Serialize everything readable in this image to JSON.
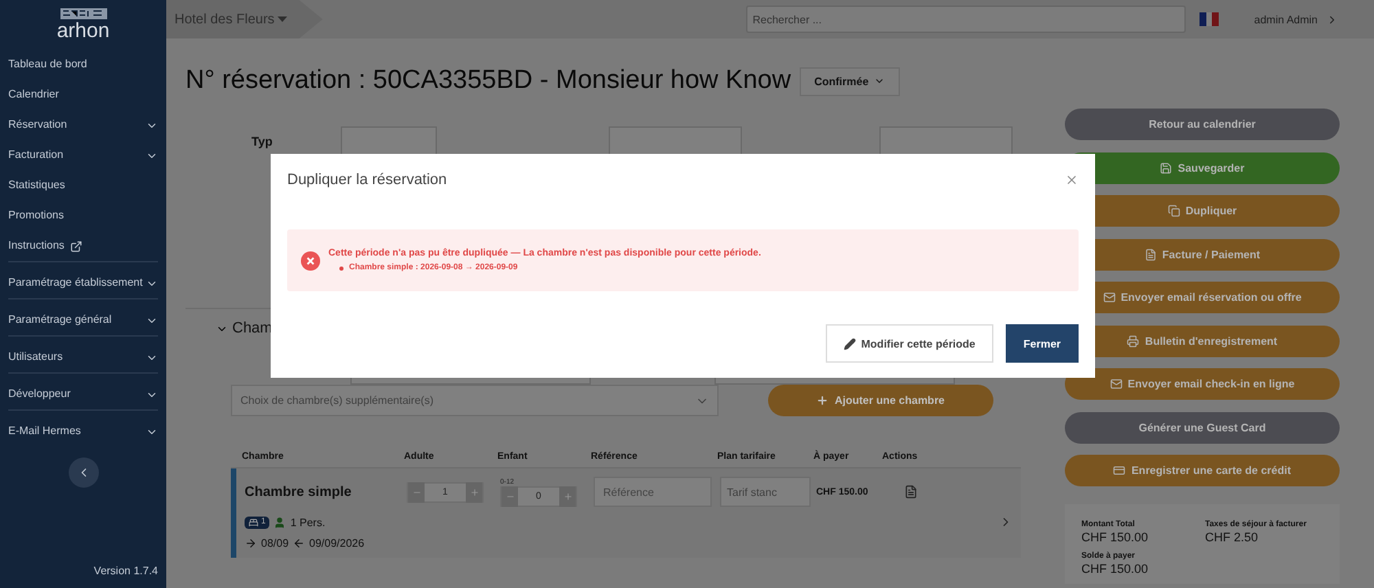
{
  "sidebar": {
    "logo": "arhon",
    "items": [
      {
        "label": "Tableau de bord",
        "kind": "link",
        "divider": false
      },
      {
        "label": "Calendrier",
        "kind": "link",
        "divider": false
      },
      {
        "label": "Réservation",
        "kind": "menu",
        "divider": false
      },
      {
        "label": "Facturation",
        "kind": "menu",
        "divider": false
      },
      {
        "label": "Statistiques",
        "kind": "link",
        "divider": false
      },
      {
        "label": "Promotions",
        "kind": "link",
        "divider": false
      },
      {
        "label": "Instructions",
        "kind": "external",
        "divider": true
      },
      {
        "label": "Paramétrage établissement",
        "kind": "menu",
        "divider": true
      },
      {
        "label": "Paramétrage général",
        "kind": "menu",
        "divider": true
      },
      {
        "label": "Utilisateurs",
        "kind": "menu",
        "divider": true
      },
      {
        "label": "Développeur",
        "kind": "menu",
        "divider": true
      },
      {
        "label": "E-Mail Hermes",
        "kind": "menu",
        "divider": false
      }
    ],
    "version": "Version 1.7.4"
  },
  "topbar": {
    "hotel": "Hotel des Fleurs",
    "search": {
      "placeholder": "Rechercher ..."
    },
    "user": "admin Admin"
  },
  "page": {
    "title": "N° réservation : 50CA3355BD - Monsieur how Know",
    "status": "Confirmée",
    "type_label": "Typ",
    "section": "Cham",
    "room_choice": {
      "placeholder": "Choix de chambre(s) supplémentaire(s)"
    },
    "add_room": "Ajouter une chambre",
    "table": {
      "columns": [
        "Chambre",
        "Adulte",
        "Enfant",
        "Référence",
        "Plan tarifaire",
        "À payer",
        "Actions"
      ],
      "rows": [
        {
          "room": "Chambre simple",
          "adults": "1",
          "children_range": "0-12",
          "children": "0",
          "reference": {
            "placeholder": "Référence"
          },
          "rate": "Tarif stanc",
          "amount": "CHF 150.00",
          "beds": "1",
          "persons": "1 Pers.",
          "arrival": "08/09",
          "departure": "09/09/2026"
        }
      ]
    }
  },
  "actions": [
    {
      "label": "Retour au calendrier",
      "color": "#4c4c52"
    },
    {
      "label": "Sauvegarder",
      "color": "#336622"
    },
    {
      "label": "Dupliquer",
      "color": "#7a5520"
    },
    {
      "label": "Facture / Paiement",
      "color": "#7a5520"
    },
    {
      "label": "Envoyer email réservation ou offre",
      "color": "#7a5520"
    },
    {
      "label": "Bulletin d'enregistrement",
      "color": "#7a5520"
    },
    {
      "label": "Envoyer email check-in en ligne",
      "color": "#7a5520"
    },
    {
      "label": "Générer une Guest Card",
      "color": "#4c4c52"
    },
    {
      "label": "Enregistrer une carte de crédit",
      "color": "#7a5520"
    }
  ],
  "summary": [
    {
      "label": "Montant Total",
      "value": "CHF 150.00"
    },
    {
      "label": "Taxes de séjour à facturer",
      "value": "CHF 2.50"
    },
    {
      "label": "Solde à payer",
      "value": "CHF 150.00"
    }
  ],
  "modal": {
    "title": "Dupliquer la réservation",
    "error": "Cette période n'a pas pu être dupliquée — La chambre n'est pas disponible pour cette période.",
    "details": [
      "Chambre simple : 2026-09-08 → 2026-09-09"
    ],
    "buttons": [
      {
        "label": "Modifier cette période",
        "kind": "secondary"
      },
      {
        "label": "Fermer",
        "kind": "primary"
      }
    ]
  }
}
